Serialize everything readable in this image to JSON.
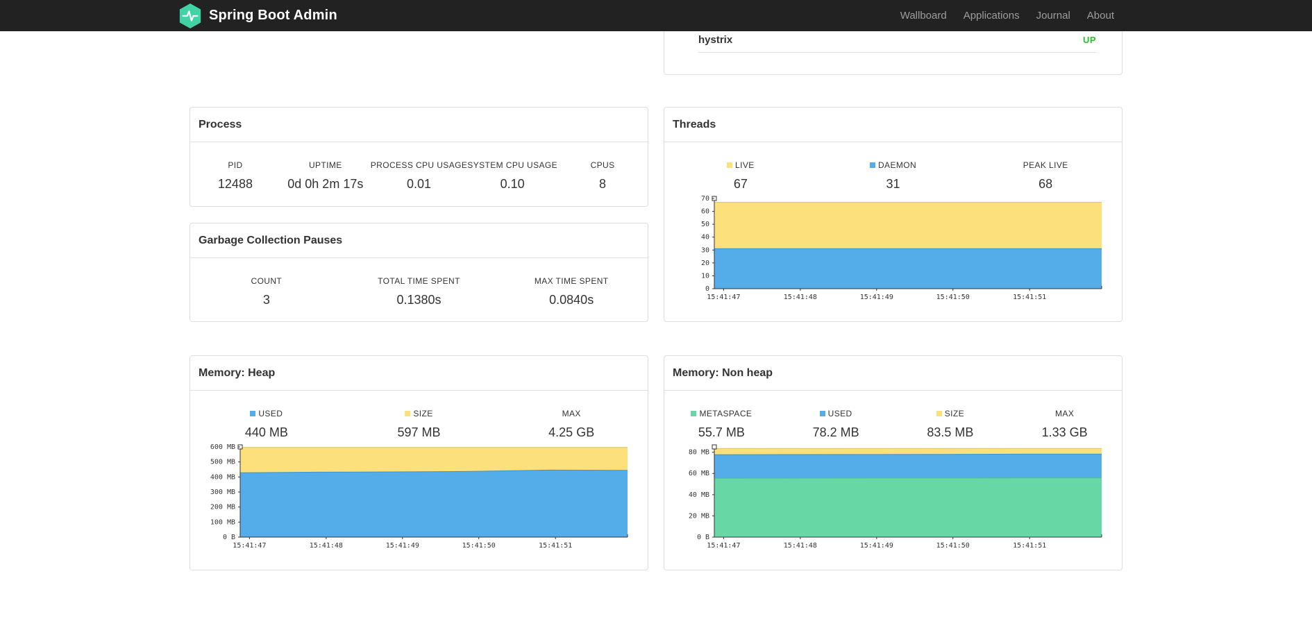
{
  "navbar": {
    "brand": "Spring Boot Admin",
    "items": [
      {
        "label": "Wallboard"
      },
      {
        "label": "Applications"
      },
      {
        "label": "Journal"
      },
      {
        "label": "About"
      }
    ]
  },
  "colors": {
    "navbar_bg": "#222222",
    "border": "#dddddd",
    "text": "#333333",
    "blue": "#54ade8",
    "yellow": "#fbe07c",
    "green": "#67d8a5",
    "status_up": "#2fbe2f"
  },
  "health": {
    "service": "hystrix",
    "status": "UP"
  },
  "process": {
    "title": "Process",
    "stats": [
      {
        "label": "PID",
        "value": "12488"
      },
      {
        "label": "UPTIME",
        "value": "0d 0h 2m 17s"
      },
      {
        "label": "PROCESS CPU USAGE",
        "value": "0.01"
      },
      {
        "label": "SYSTEM CPU USAGE",
        "value": "0.10"
      },
      {
        "label": "CPUS",
        "value": "8"
      }
    ]
  },
  "gc": {
    "title": "Garbage Collection Pauses",
    "stats": [
      {
        "label": "COUNT",
        "value": "3"
      },
      {
        "label": "TOTAL TIME SPENT",
        "value": "0.1380s"
      },
      {
        "label": "MAX TIME SPENT",
        "value": "0.0840s"
      }
    ]
  },
  "threads": {
    "title": "Threads",
    "stats": [
      {
        "label": "LIVE",
        "value": "67",
        "swatch": "yellow"
      },
      {
        "label": "DAEMON",
        "value": "31",
        "swatch": "blue"
      },
      {
        "label": "PEAK LIVE",
        "value": "68"
      }
    ]
  },
  "heap": {
    "title": "Memory: Heap",
    "stats": [
      {
        "label": "USED",
        "value": "440 MB",
        "swatch": "blue"
      },
      {
        "label": "SIZE",
        "value": "597 MB",
        "swatch": "yellow"
      },
      {
        "label": "MAX",
        "value": "4.25 GB"
      }
    ]
  },
  "nonheap": {
    "title": "Memory: Non heap",
    "stats": [
      {
        "label": "METASPACE",
        "value": "55.7 MB",
        "swatch": "green"
      },
      {
        "label": "USED",
        "value": "78.2 MB",
        "swatch": "blue"
      },
      {
        "label": "SIZE",
        "value": "83.5 MB",
        "swatch": "yellow"
      },
      {
        "label": "MAX",
        "value": "1.33 GB"
      }
    ]
  },
  "chart_data": [
    {
      "id": "threads",
      "type": "area",
      "title": "Threads",
      "ylim": [
        0,
        70
      ],
      "ymax": 70,
      "grid": false,
      "yticks": [
        {
          "v": 0,
          "label": "0"
        },
        {
          "v": 10,
          "label": "10"
        },
        {
          "v": 20,
          "label": "20"
        },
        {
          "v": 30,
          "label": "30"
        },
        {
          "v": 40,
          "label": "40"
        },
        {
          "v": 50,
          "label": "50"
        },
        {
          "v": 60,
          "label": "60"
        },
        {
          "v": 70,
          "label": "70"
        }
      ],
      "x_labels": [
        "15:41:47",
        "15:41:48",
        "15:41:49",
        "15:41:50",
        "15:41:51"
      ],
      "xtick_fractions": [
        0.024,
        0.222,
        0.419,
        0.616,
        0.814
      ],
      "series": [
        {
          "name": "LIVE",
          "color": "#fbe07c",
          "edge": "#dcc160",
          "values": [
            67,
            67,
            67,
            67,
            67,
            67
          ]
        },
        {
          "name": "DAEMON",
          "color": "#54ade8",
          "edge": "#3d93cd",
          "values": [
            31,
            31,
            31,
            31,
            31,
            31
          ]
        }
      ]
    },
    {
      "id": "heap",
      "type": "area",
      "title": "Memory: Heap",
      "ylim": [
        0,
        600
      ],
      "ymax": 600,
      "grid": false,
      "yticks": [
        {
          "v": 0,
          "label": "0 B"
        },
        {
          "v": 100,
          "label": "100 MB"
        },
        {
          "v": 200,
          "label": "200 MB"
        },
        {
          "v": 300,
          "label": "300 MB"
        },
        {
          "v": 400,
          "label": "400 MB"
        },
        {
          "v": 500,
          "label": "500 MB"
        },
        {
          "v": 600,
          "label": "600 MB"
        }
      ],
      "x_labels": [
        "15:41:47",
        "15:41:48",
        "15:41:49",
        "15:41:50",
        "15:41:51"
      ],
      "xtick_fractions": [
        0.024,
        0.222,
        0.419,
        0.616,
        0.814
      ],
      "series": [
        {
          "name": "SIZE",
          "color": "#fbe07c",
          "edge": "#dcc160",
          "values": [
            597,
            597,
            597,
            597,
            597,
            597
          ]
        },
        {
          "name": "USED",
          "color": "#54ade8",
          "edge": "#3d93cd",
          "values": [
            428,
            432,
            434,
            437,
            446,
            444
          ]
        }
      ]
    },
    {
      "id": "nonheap",
      "type": "area",
      "title": "Memory: Non heap",
      "ylim": [
        0,
        85
      ],
      "ymax": 85,
      "grid": false,
      "yticks": [
        {
          "v": 0,
          "label": "0 B"
        },
        {
          "v": 20,
          "label": "20 MB"
        },
        {
          "v": 40,
          "label": "40 MB"
        },
        {
          "v": 60,
          "label": "60 MB"
        },
        {
          "v": 80,
          "label": "80 MB"
        }
      ],
      "x_labels": [
        "15:41:47",
        "15:41:48",
        "15:41:49",
        "15:41:50",
        "15:41:51"
      ],
      "xtick_fractions": [
        0.024,
        0.222,
        0.419,
        0.616,
        0.814
      ],
      "series": [
        {
          "name": "SIZE",
          "color": "#fbe07c",
          "edge": "#dcc160",
          "values": [
            83.5,
            83.5,
            83.5,
            83.5,
            83.5,
            83.5
          ]
        },
        {
          "name": "USED",
          "color": "#54ade8",
          "edge": "#3d93cd",
          "values": [
            77.6,
            77.8,
            77.9,
            78.0,
            78.2,
            78.2
          ]
        },
        {
          "name": "METASPACE",
          "color": "#67d8a5",
          "edge": "#4cc28e",
          "values": [
            55.4,
            55.5,
            55.6,
            55.6,
            55.7,
            55.7
          ]
        }
      ]
    }
  ]
}
